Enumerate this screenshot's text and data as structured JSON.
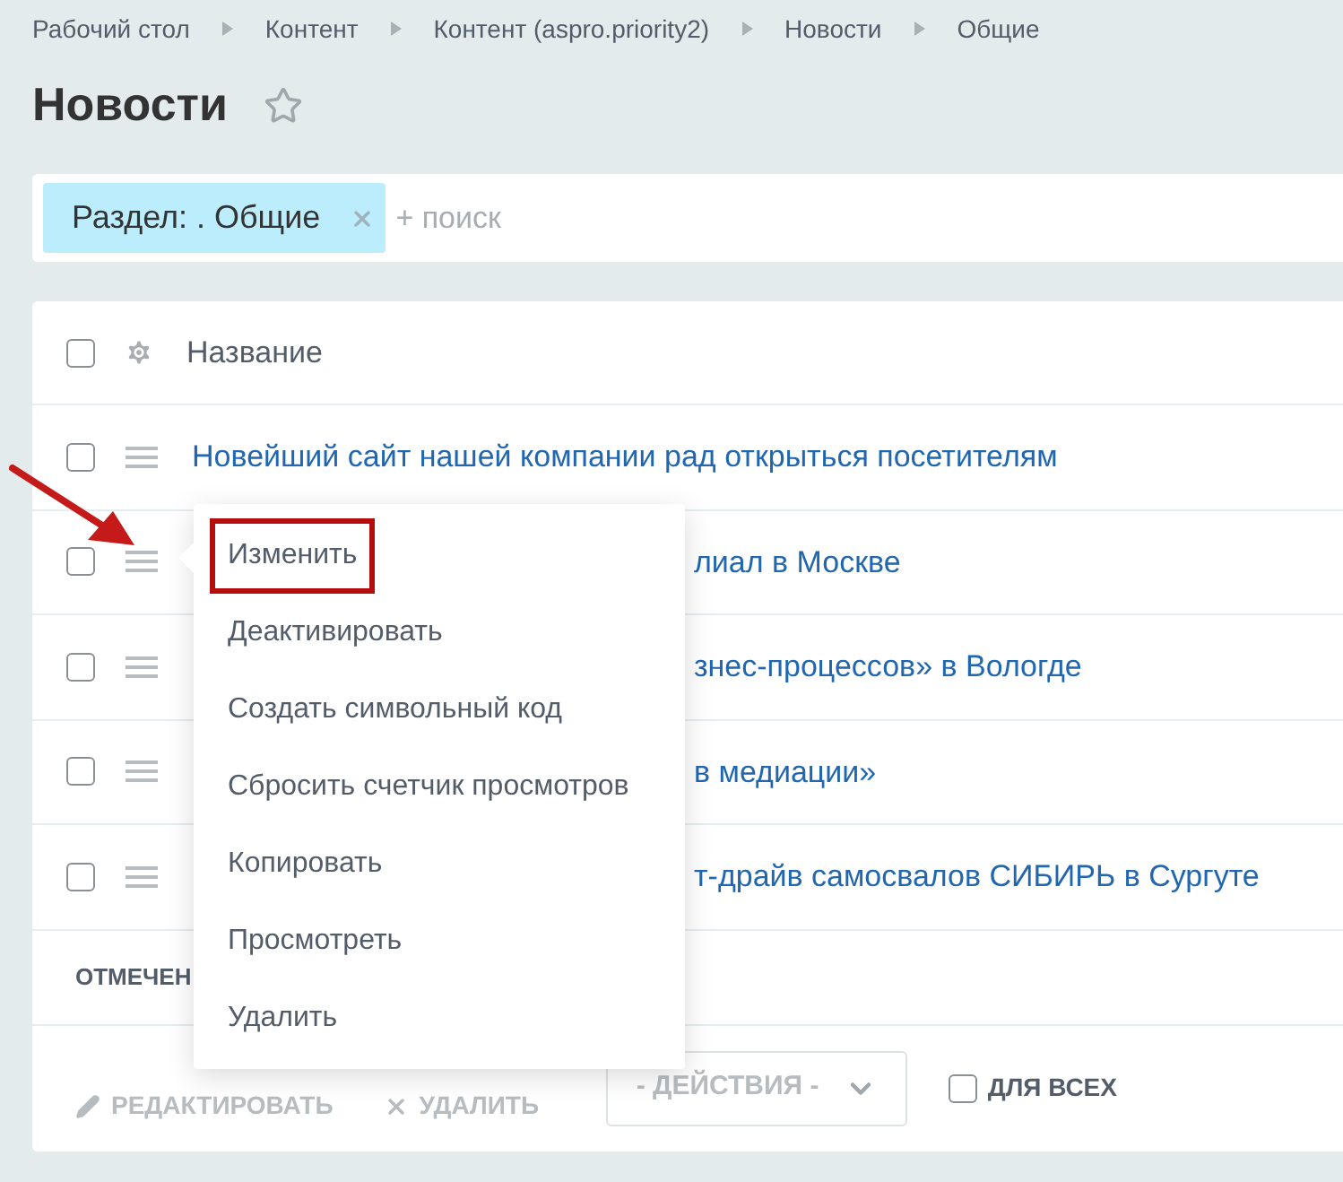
{
  "breadcrumbs": [
    "Рабочий стол",
    "Контент",
    "Контент (aspro.priority2)",
    "Новости",
    "Общие"
  ],
  "title": "Новости",
  "favorite": false,
  "filter": {
    "tag": "Раздел: . Общие",
    "placeholder": "+ поиск"
  },
  "table": {
    "header": "Название",
    "all_checked": false,
    "rows": [
      {
        "title": "Новейший сайт нашей компании рад открыться посетителям",
        "checked": false,
        "covered": false
      },
      {
        "title": "лиал в Москве",
        "checked": false,
        "covered": true
      },
      {
        "title": "знес-процессов» в Вологде",
        "checked": false,
        "covered": true
      },
      {
        "title": "в медиации»",
        "checked": false,
        "covered": true
      },
      {
        "title": "т-драйв самосвалов СИБИРЬ в Сургуте",
        "checked": false,
        "covered": true
      }
    ]
  },
  "footer_label": "ОТМЕЧЕН",
  "toolbar": {
    "edit": "РЕДАКТИРОВАТЬ",
    "delete": "УДАЛИТЬ",
    "actions": "- ДЕЙСТВИЯ -",
    "for_all": {
      "label": "ДЛЯ ВСЕХ",
      "checked": false
    }
  },
  "menu": {
    "items": [
      {
        "label": "Изменить",
        "highlighted": true
      },
      {
        "label": "Деактивировать",
        "highlighted": false
      },
      {
        "label": "Создать символьный код",
        "highlighted": false
      },
      {
        "label": "Сбросить счетчик просмотров",
        "highlighted": false
      },
      {
        "label": "Копировать",
        "highlighted": false
      },
      {
        "label": "Просмотреть",
        "highlighted": false
      },
      {
        "label": "Удалить",
        "highlighted": false
      }
    ]
  }
}
